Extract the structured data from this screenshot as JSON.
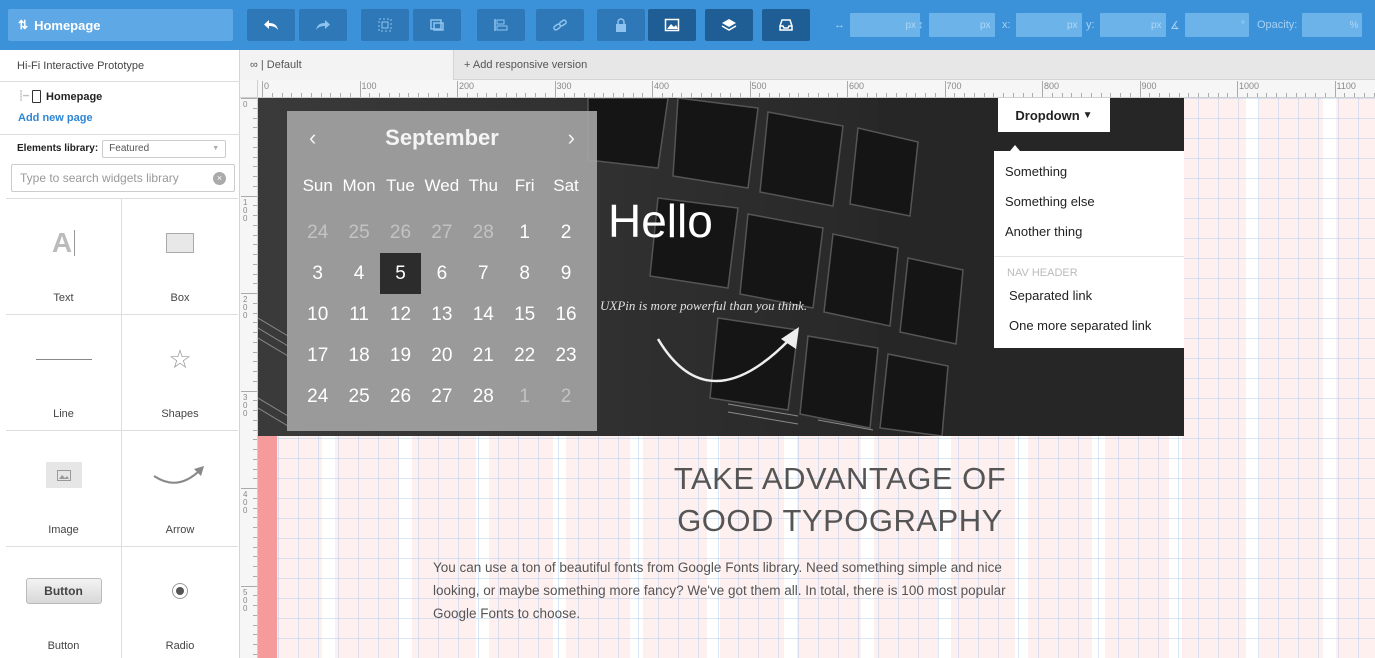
{
  "toolbar": {
    "page_label": "Homepage",
    "fields": {
      "width_label": "↔",
      "height_label": "↕",
      "x_label": "x:",
      "y_label": "y:",
      "angle_label": "∡",
      "opacity_label": "Opacity:",
      "px_unit": "px",
      "deg_unit": "°",
      "pct_unit": "%"
    }
  },
  "left_panel": {
    "project_title": "Hi-Fi Interactive Prototype",
    "current_page": "Homepage",
    "add_page": "Add new page",
    "library_label": "Elements library:",
    "library_selected": "Featured",
    "search_placeholder": "Type to search widgets library",
    "widgets": [
      {
        "label": "Text",
        "icon": "text-widget-icon"
      },
      {
        "label": "Box",
        "icon": "box-widget-icon"
      },
      {
        "label": "Line",
        "icon": "line-widget-icon"
      },
      {
        "label": "Shapes",
        "icon": "star-icon"
      },
      {
        "label": "Image",
        "icon": "image-icon"
      },
      {
        "label": "Arrow",
        "icon": "arrow-icon"
      },
      {
        "label": "Button",
        "icon": "button-widget-icon",
        "preview_text": "Button"
      },
      {
        "label": "Radio",
        "icon": "radio-icon"
      }
    ]
  },
  "canvas": {
    "tab_default": "∞ | Default",
    "tab_add": "+ Add responsive version",
    "ruler_h": [
      "0",
      "100",
      "200",
      "300",
      "400",
      "500",
      "600",
      "700",
      "800",
      "900",
      "1000",
      "1100"
    ],
    "ruler_v": [
      "0",
      "100",
      "200",
      "300",
      "400",
      "500"
    ]
  },
  "hero": {
    "title": "Hello",
    "subtitle": "UXPin is more powerful than you think."
  },
  "calendar": {
    "month": "September",
    "prev": "‹",
    "next": "›",
    "day_names": [
      "Sun",
      "Mon",
      "Tue",
      "Wed",
      "Thu",
      "Fri",
      "Sat"
    ],
    "weeks": [
      [
        "24",
        "25",
        "26",
        "27",
        "28",
        "1",
        "2"
      ],
      [
        "3",
        "4",
        "5",
        "6",
        "7",
        "8",
        "9"
      ],
      [
        "10",
        "11",
        "12",
        "13",
        "14",
        "15",
        "16"
      ],
      [
        "17",
        "18",
        "19",
        "20",
        "21",
        "22",
        "23"
      ],
      [
        "24",
        "25",
        "26",
        "27",
        "28",
        "1",
        "2"
      ]
    ],
    "selected": "5"
  },
  "dropdown": {
    "label": "Dropdown",
    "items": [
      "Something",
      "Something else",
      "Another thing"
    ],
    "header": "NAV HEADER",
    "separated": [
      "Separated link",
      "One more separated link"
    ]
  },
  "typography": {
    "title_line1": "TAKE ADVANTAGE OF",
    "title_line2": "GOOD TYPOGRAPHY",
    "body": "You can use a ton of beautiful fonts from Google Fonts library. Need something simple and nice looking, or maybe something more fancy? We've got them all. In total, there is 100 most popular Google Fonts to choose."
  },
  "colors": {
    "toolbar": "#3c92d8",
    "accent": "#2e86d6",
    "margin": "#f69b9b"
  }
}
